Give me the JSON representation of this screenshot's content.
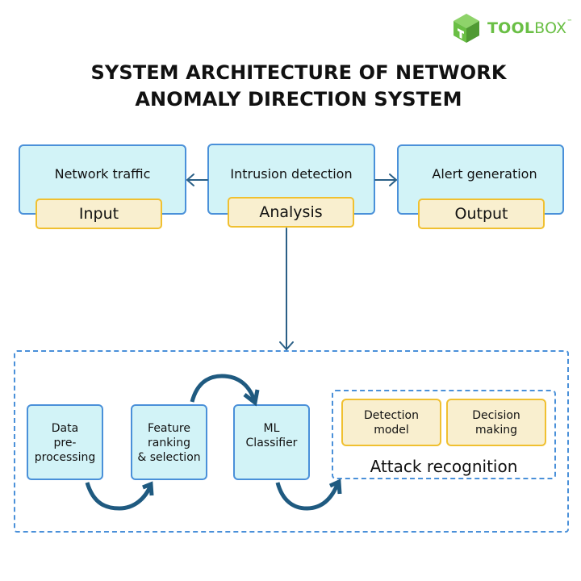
{
  "logo": {
    "icon": "cube-logo-icon",
    "text_bold": "TOOL",
    "text_regular": "BOX",
    "trademark": "™",
    "color": "#6abf45"
  },
  "title": {
    "line1": "SYSTEM ARCHITECTURE OF NETWORK",
    "line2": "ANOMALY DIRECTION SYSTEM"
  },
  "top_row": [
    {
      "label": "Network traffic",
      "tag": "Input"
    },
    {
      "label": "Intrusion detection",
      "tag": "Analysis"
    },
    {
      "label": "Alert generation",
      "tag": "Output"
    }
  ],
  "pipeline": {
    "steps": [
      {
        "lines": [
          "Data",
          "pre-",
          "processing"
        ]
      },
      {
        "lines": [
          "Feature",
          "ranking",
          "& selection"
        ]
      },
      {
        "lines": [
          "ML",
          "Classifier"
        ]
      }
    ],
    "attack_recognition": {
      "label": "Attack recognition",
      "parts": [
        {
          "lines": [
            "Detection",
            "model"
          ]
        },
        {
          "lines": [
            "Decision",
            "making"
          ]
        }
      ]
    }
  },
  "colors": {
    "box_fill": "#d2f3f7",
    "box_border": "#4a90d9",
    "tag_fill": "#f9efcf",
    "tag_border": "#f0c030",
    "arrow": "#1f5a80"
  }
}
